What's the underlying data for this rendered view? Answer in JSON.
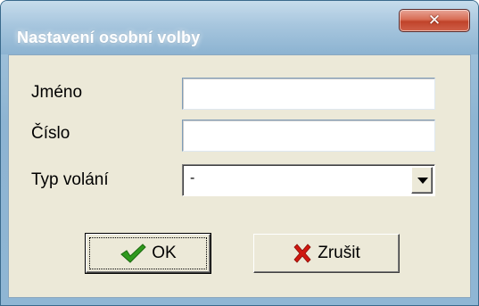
{
  "window": {
    "title": "Nastavení osobní volby",
    "close_icon": "close-icon"
  },
  "form": {
    "name_label": "Jméno",
    "name_value": "",
    "number_label": "Číslo",
    "number_value": "",
    "call_type_label": "Typ volání",
    "call_type_value": "-"
  },
  "buttons": {
    "ok_label": "OK",
    "ok_icon": "checkmark-icon",
    "cancel_label": "Zrušit",
    "cancel_icon": "red-x-icon"
  },
  "colors": {
    "ok_check": "#2f9a1e",
    "cancel_x": "#d01810",
    "close_button": "#c8452c"
  }
}
